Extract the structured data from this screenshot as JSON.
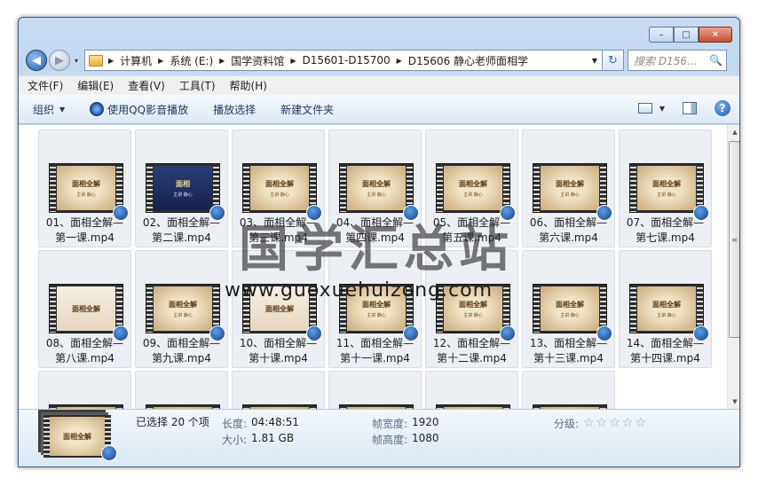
{
  "caption": {
    "minimize": "–",
    "maximize": "□",
    "close": "✕"
  },
  "nav": {
    "back_icon": "◀",
    "forward_icon": "▶",
    "recent_icon": "▾"
  },
  "address": {
    "crumbs": [
      "计算机",
      "系统 (E:)",
      "国学资料馆",
      "D15601-D15700",
      "D15606 静心老师面相学"
    ],
    "refresh_icon": "↻"
  },
  "search": {
    "placeholder": "搜索 D156...",
    "icon": "🔍"
  },
  "menu": [
    "文件(F)",
    "编辑(E)",
    "查看(V)",
    "工具(T)",
    "帮助(H)"
  ],
  "toolbar": {
    "organize": "组织",
    "play_qq": "使用QQ影音播放",
    "play_selection": "播放选择",
    "new_folder": "新建文件夹",
    "help": "?"
  },
  "files": [
    {
      "name": "01、面相全解—\n第一课.mp4",
      "thumb": "title"
    },
    {
      "name": "02、面相全解—\n第二课.mp4",
      "thumb": "dark"
    },
    {
      "name": "03、面相全解—\n第三课.mp4",
      "thumb": "title"
    },
    {
      "name": "04、面相全解—\n第四课.mp4",
      "thumb": "title"
    },
    {
      "name": "05、面相全解—\n第五课.mp4",
      "thumb": "title"
    },
    {
      "name": "06、面相全解—\n第六课.mp4",
      "thumb": "title"
    },
    {
      "name": "07、面相全解—\n第七课.mp4",
      "thumb": "title"
    },
    {
      "name": "08、面相全解—\n第八课.mp4",
      "thumb": "slide"
    },
    {
      "name": "09、面相全解—\n第九课.mp4",
      "thumb": "title"
    },
    {
      "name": "10、面相全解—\n第十课.mp4",
      "thumb": "slide"
    },
    {
      "name": "11、面相全解—\n第十一课.mp4",
      "thumb": "title"
    },
    {
      "name": "12、面相全解—\n第十二课.mp4",
      "thumb": "title"
    },
    {
      "name": "13、面相全解—\n第十三课.mp4",
      "thumb": "title"
    },
    {
      "name": "14、面相全解—\n第十四课.mp4",
      "thumb": "title"
    },
    {
      "name": "",
      "thumb": "title"
    },
    {
      "name": "",
      "thumb": "title"
    },
    {
      "name": "",
      "thumb": "title"
    },
    {
      "name": "",
      "thumb": "title"
    },
    {
      "name": "",
      "thumb": "title"
    },
    {
      "name": "",
      "thumb": "title"
    }
  ],
  "thumb_text": {
    "title": "面相全解",
    "presenter": "主讲 静心",
    "dark_title": "面相"
  },
  "watermark": {
    "cn": "国学汇总站",
    "url": "www.guoxuehuizong.com"
  },
  "details": {
    "selected": "已选择 20 个项",
    "duration_label": "长度:",
    "duration": "04:48:51",
    "size_label": "大小:",
    "size": "1.81 GB",
    "frame_width_label": "帧宽度:",
    "frame_width": "1920",
    "frame_height_label": "帧高度:",
    "frame_height": "1080",
    "rating_label": "分级:",
    "rating_stars": "☆☆☆☆☆"
  },
  "scrollbar": {
    "up": "▲",
    "down": "▼",
    "grip": "≡"
  }
}
